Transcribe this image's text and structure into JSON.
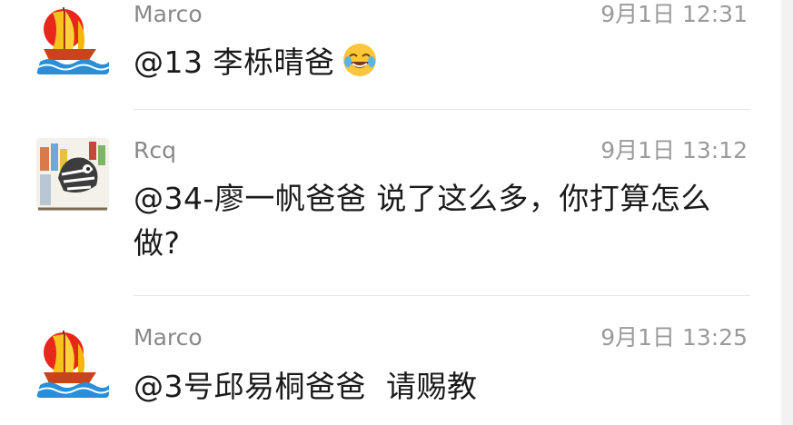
{
  "comments": [
    {
      "author": "Marco",
      "time": "9月1日 12:31",
      "text": "@13 李栎晴爸",
      "emoji": "laughing-crying-emoji"
    },
    {
      "author": "Rcq",
      "time": "9月1日 13:12",
      "text": "@34-廖一帆爸爸 说了这么多，你打算怎么做?"
    },
    {
      "author": "Marco",
      "time": "9月1日 13:25",
      "text": "@3号邱易桐爸爸  请赐教"
    }
  ]
}
